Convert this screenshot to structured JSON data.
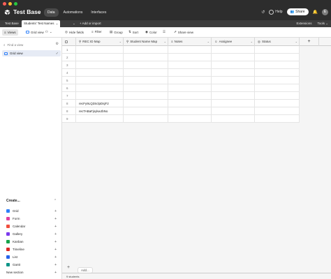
{
  "app": {
    "base_title": "Test Base",
    "nav": [
      {
        "label": "Data",
        "active": true
      },
      {
        "label": "Automations",
        "active": false
      },
      {
        "label": "Interfaces",
        "active": false
      }
    ],
    "help_label": "Help",
    "share_label": "Share",
    "avatar_initial": "E"
  },
  "tabs": {
    "items": [
      {
        "label": "Test Base",
        "active": false
      },
      {
        "label": "Students' Test Names",
        "active": true
      }
    ],
    "add_label": "+ Add or import",
    "extensions_label": "Extensions",
    "tools_label": "Tools"
  },
  "toolbar": {
    "views_label": "Views",
    "view_name": "Grid view",
    "hide_fields": "Hide fields",
    "filter": "Filter",
    "group": "Group",
    "sort": "Sort",
    "color": "Color",
    "share_view": "Share view"
  },
  "sidebar": {
    "find_placeholder": "Find a view",
    "current_view": "Grid view",
    "create_title": "Create...",
    "create_items": [
      {
        "label": "Grid",
        "icon": "grid-icon",
        "color": "#2d7ff9"
      },
      {
        "label": "Form",
        "icon": "form-icon",
        "color": "#e040a0"
      },
      {
        "label": "Calendar",
        "icon": "calendar-icon",
        "color": "#f04e3e"
      },
      {
        "label": "Gallery",
        "icon": "gallery-icon",
        "color": "#7c3aed"
      },
      {
        "label": "Kanban",
        "icon": "kanban-icon",
        "color": "#16a34a"
      },
      {
        "label": "Timeline",
        "icon": "timeline-icon",
        "color": "#dc2626"
      },
      {
        "label": "List",
        "icon": "list-icon",
        "color": "#2563eb"
      },
      {
        "label": "Gantt",
        "icon": "gantt-icon",
        "color": "#0d9488"
      },
      {
        "label": "New section",
        "icon": "",
        "color": ""
      }
    ]
  },
  "grid": {
    "columns": [
      {
        "label": "REC ID Map"
      },
      {
        "label": "Student Name Map"
      },
      {
        "label": "Notes"
      },
      {
        "label": "Assignee"
      },
      {
        "label": "Status"
      }
    ],
    "rows": [
      {
        "n": "1",
        "rec": ""
      },
      {
        "n": "2",
        "rec": ""
      },
      {
        "n": "3",
        "rec": ""
      },
      {
        "n": "4",
        "rec": ""
      },
      {
        "n": "5",
        "rec": ""
      },
      {
        "n": "6",
        "rec": ""
      },
      {
        "n": "7",
        "rec": ""
      },
      {
        "n": "8",
        "rec": "recFy9LQ3SclpDsjF2"
      },
      {
        "n": "8",
        "rec": "recTABaFjsykwJbNo"
      },
      {
        "n": "9",
        "rec": ""
      }
    ],
    "add_row_label": "Add...",
    "status_text": "9 students"
  }
}
